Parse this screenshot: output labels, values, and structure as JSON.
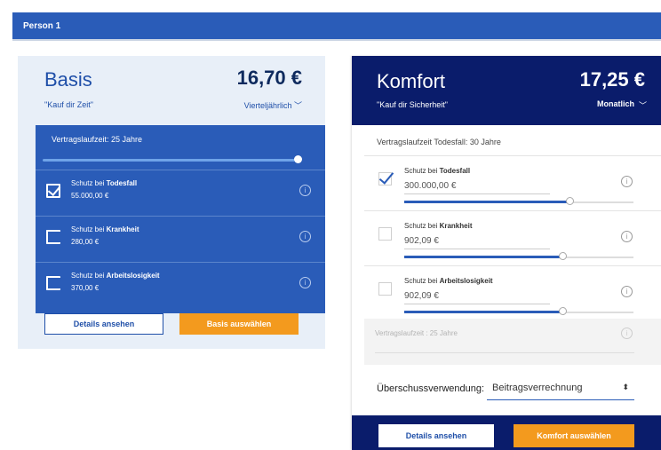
{
  "header": {
    "person_label": "Person 1"
  },
  "basis": {
    "title": "Basis",
    "price": "16,70 €",
    "slogan": "\"Kauf dir Zeit\"",
    "frequency": "Vierteljährlich",
    "term": "Vertragslaufzeit: 25 Jahre",
    "items": [
      {
        "label_prefix": "Schutz bei ",
        "label_bold": "Todesfall",
        "amount": "55.000,00 €",
        "checked": true
      },
      {
        "label_prefix": "Schutz bei ",
        "label_bold": "Krankheit",
        "amount": "280,00 €",
        "checked": false
      },
      {
        "label_prefix": "Schutz bei ",
        "label_bold": "Arbeitslosigkeit",
        "amount": "370,00 €",
        "checked": false
      }
    ],
    "details_button": "Details ansehen",
    "select_button": "Basis auswählen"
  },
  "komfort": {
    "title": "Komfort",
    "price": "17,25 €",
    "slogan": "\"Kauf dir Sicherheit\"",
    "frequency": "Monatlich",
    "term": "Vertragslaufzeit Todesfall: 30 Jahre",
    "items": [
      {
        "label_prefix": "Schutz bei ",
        "label_bold": "Todesfall",
        "amount": "300.000,00 €",
        "checked": true,
        "slider": 0.72
      },
      {
        "label_prefix": "Schutz bei ",
        "label_bold": "Krankheit",
        "amount": "902,09 €",
        "checked": false,
        "slider": 0.69
      },
      {
        "label_prefix": "Schutz bei ",
        "label_bold": "Arbeitslosigkeit",
        "amount": "902,09 €",
        "checked": false,
        "slider": 0.69
      }
    ],
    "disabled_term": "Vertragslaufzeit : 25 Jahre",
    "surplus_label": "Überschussverwendung:",
    "surplus_value": "Beitragsverrechnung",
    "details_button": "Details ansehen",
    "select_button": "Komfort auswählen"
  }
}
